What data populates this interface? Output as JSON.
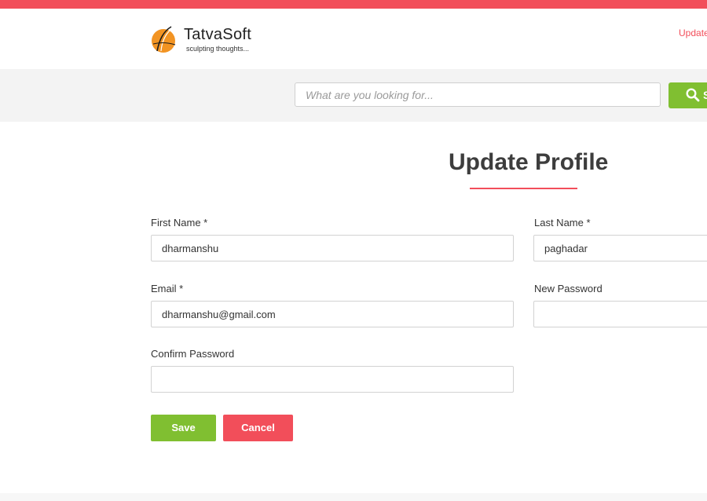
{
  "brand": {
    "name": "TatvaSoft",
    "tagline": "sculpting thoughts...",
    "accent_color": "#f24e5a",
    "primary_color": "#80bf31",
    "logo_color": "#f29423"
  },
  "header": {
    "link_label": "Update"
  },
  "search": {
    "placeholder": "What are you looking for...",
    "button_label": "S",
    "button_icon": "search-icon"
  },
  "page": {
    "title": "Update Profile"
  },
  "form": {
    "first_name": {
      "label": "First Name *",
      "value": "dharmanshu"
    },
    "last_name": {
      "label": "Last Name *",
      "value": "paghadar"
    },
    "email": {
      "label": "Email *",
      "value": "dharmanshu@gmail.com"
    },
    "new_password": {
      "label": "New Password",
      "value": ""
    },
    "confirm_password": {
      "label": "Confirm Password",
      "value": ""
    }
  },
  "actions": {
    "save_label": "Save",
    "cancel_label": "Cancel"
  }
}
